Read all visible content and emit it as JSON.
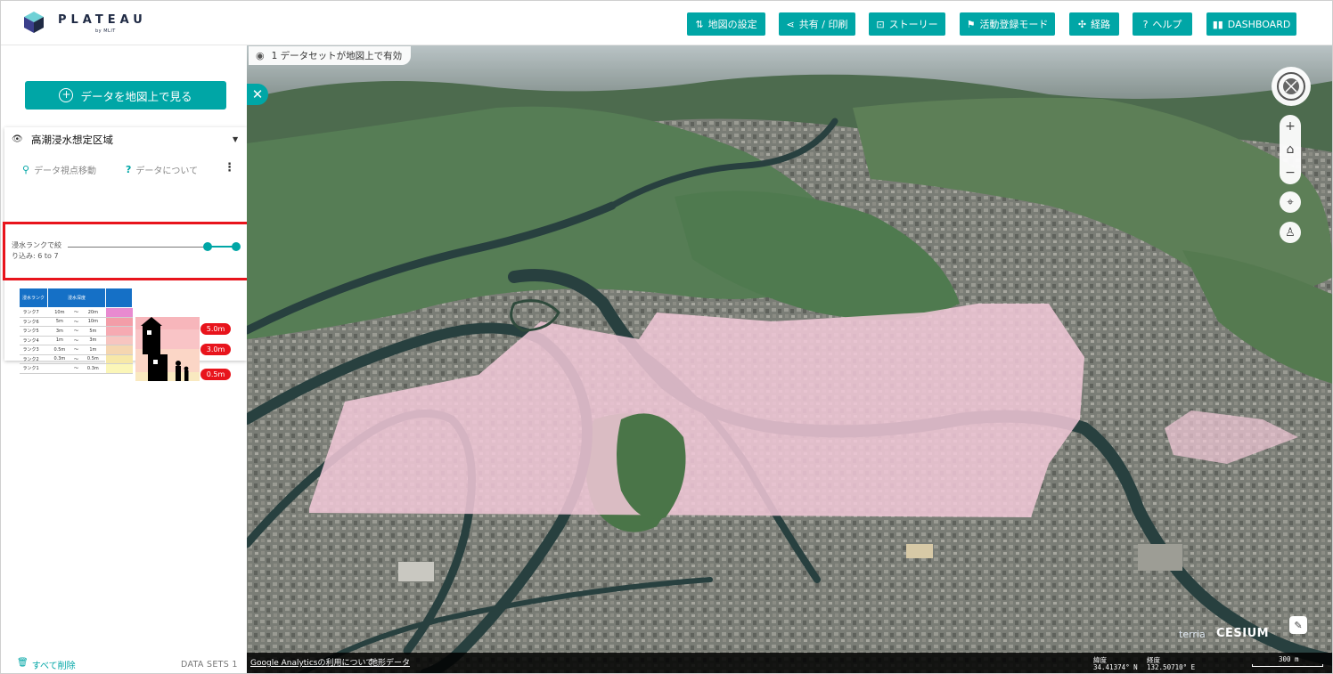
{
  "header": {
    "logo_text": "PLATEAU",
    "logo_sub": "by MLIT",
    "nav": [
      {
        "label": "地図の設定",
        "icon": "sliders-icon",
        "glyph": "⇅"
      },
      {
        "label": "共有 / 印刷",
        "icon": "share-icon",
        "glyph": "⋖"
      },
      {
        "label": "ストーリー",
        "icon": "story-icon",
        "glyph": "⊡"
      },
      {
        "label": "活動登録モード",
        "icon": "people-icon",
        "glyph": "⚑"
      },
      {
        "label": "経路",
        "icon": "route-icon",
        "glyph": "✣"
      },
      {
        "label": "ヘルプ",
        "icon": "help-icon",
        "glyph": "?"
      },
      {
        "label": "DASHBOARD",
        "icon": "book-icon",
        "glyph": "▮▮"
      }
    ]
  },
  "sidebar": {
    "add_data_label": "データを地図上で見る",
    "dataset": {
      "title": "高潮浸水想定区域",
      "action_zoom": "データ視点移動",
      "action_about": "データについて",
      "filter_label": "浸水ランクで絞り込み: 6 to 7",
      "filter_min": 6,
      "filter_max": 7
    },
    "legend": {
      "col_rank": "浸水ランク",
      "col_depth": "浸水深度",
      "rows": [
        {
          "rank": "ランク7",
          "from": "10m",
          "sep": "〜",
          "to": "20m",
          "color": "#e88ad0"
        },
        {
          "rank": "ランク6",
          "from": "5m",
          "sep": "〜",
          "to": "10m",
          "color": "#f39da8"
        },
        {
          "rank": "ランク5",
          "from": "3m",
          "sep": "〜",
          "to": "5m",
          "color": "#f6aab2"
        },
        {
          "rank": "ランク4",
          "from": "1m",
          "sep": "〜",
          "to": "3m",
          "color": "#f7c5c0"
        },
        {
          "rank": "ランク3",
          "from": "0.5m",
          "sep": "〜",
          "to": "1m",
          "color": "#f5d6b0"
        },
        {
          "rank": "ランク2",
          "from": "0.3m",
          "sep": "〜",
          "to": "0.5m",
          "color": "#f7e8a8"
        },
        {
          "rank": "ランク1",
          "from": "",
          "sep": "〜",
          "to": "0.3m",
          "color": "#fbf6b8"
        }
      ],
      "depth_marks": [
        "5.0m",
        "3.0m",
        "0.5m"
      ]
    },
    "delete_all_label": "すべて削除",
    "datasets_count": "DATA SETS 1"
  },
  "map": {
    "status": "1 データセットが地図上で有効",
    "footer_link_analytics": "Google Analyticsの利用について",
    "footer_link_data": "地形データ",
    "lat_label": "緯度",
    "lat_value": "34.41374° N",
    "lon_label": "経度",
    "lon_value": "132.50710° E",
    "scale_label": "300 m",
    "terria_label": "terria",
    "cesium_label": "CESIUM",
    "flood_color": "#f3c9d9"
  }
}
